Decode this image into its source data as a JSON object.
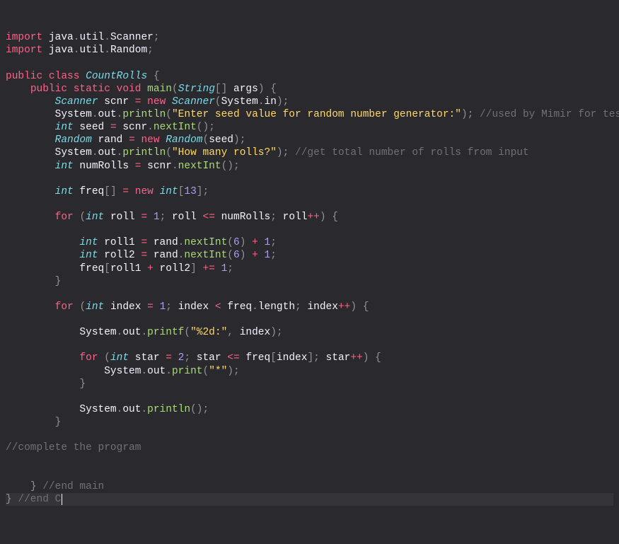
{
  "imp1_kw": "import",
  "imp1_pkg": " java",
  "imp1_d1": ".",
  "imp1_util": "util",
  "imp1_d2": ".",
  "imp1_cls": "Scanner",
  "sc": ";",
  "imp2_cls": "Random",
  "kw_public": "public",
  "kw_class": "class",
  "cls_name": "CountRolls",
  "ob": " {",
  "kw_static": "static",
  "kw_void": "void",
  "m_main": "main",
  "p_o": "(",
  "p_c": ")",
  "type_string": "String",
  "arr_br": "[] ",
  "p_args": "args",
  "cb_o": " {",
  "cb_c": "}",
  "type_scanner": "Scanner",
  "v_scnr": " scnr ",
  "op_eq": "=",
  "kw_new": " new ",
  "sys": "System",
  "dot": ".",
  "in": "in",
  "out": "out",
  "m_println": "println",
  "m_printf": "printf",
  "m_print": "print",
  "s_seed": "\"Enter seed value for random number generator:\"",
  "c_mimir": " //used by Mimir for testing",
  "type_int": "int",
  "v_seed": " seed ",
  "m_nextInt": "nextInt",
  "type_random": "Random",
  "v_rand": " rand ",
  "s_rolls": "\"How many rolls?\"",
  "c_rolls": " //get total number of rolls from input",
  "v_numRolls": " numRolls ",
  "v_freq": " freq",
  "br_o": "[",
  "br_c": "]",
  "n13": "13",
  "kw_for": "for",
  "v_roll": " roll ",
  "n1": "1",
  "op_le": "<=",
  "op_pp": "++",
  "v_roll1": " roll1 ",
  "v_roll2": " roll2 ",
  "n6": "6",
  "op_plus": "+",
  "op_peq": "+=",
  "v_index": " index ",
  "op_lt": "<",
  "f_length": "length",
  "s_fmt": "\"%2d:\"",
  "cm": ", ",
  "v_star": " star ",
  "n2": "2",
  "s_star": "\"*\"",
  "c_complete": "//complete the program",
  "c_endmain": " //end main",
  "c_endc": " //end C"
}
